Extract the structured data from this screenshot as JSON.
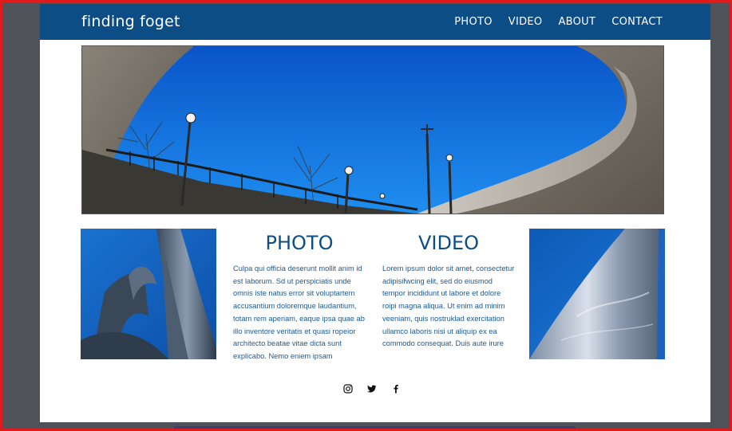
{
  "brand": {
    "title": "finding foget"
  },
  "nav": {
    "items": [
      "PHOTO",
      "VIDEO",
      "ABOUT",
      "CONTACT"
    ]
  },
  "sections": {
    "photo": {
      "heading": "PHOTO",
      "text": "Culpa qui officia deserunt mollit anim id est laborum. Sd ut perspiciatis unde omnis iste natus error sit voluptartem accusantium doloremque laudantium, totam rem aperiam, eaque ipsa quae ab illo inventore veritatis et quasi ropeior architecto beatae vitae dicta sunt explicabo. Nemo eniem ipsam"
    },
    "video": {
      "heading": "VIDEO",
      "text": "Lorem ipsum dolor sit amet, consectetur adipisifwcing elit, sed do eiusmod tempor incididunt ut labore et dolore roipi magna aliqua. Ut enim ad minim veeniam, quis nostruklad exercitation ullamco laboris nisi ut aliquip ex ea commodo consequat. Duis aute irure"
    }
  },
  "social": {
    "icons": [
      "instagram-icon",
      "twitter-icon",
      "facebook-icon"
    ]
  },
  "colors": {
    "navbar": "#0d4d86",
    "heading": "#0d4d86",
    "body_text": "#1c5a94",
    "backdrop": "#4f5258"
  }
}
